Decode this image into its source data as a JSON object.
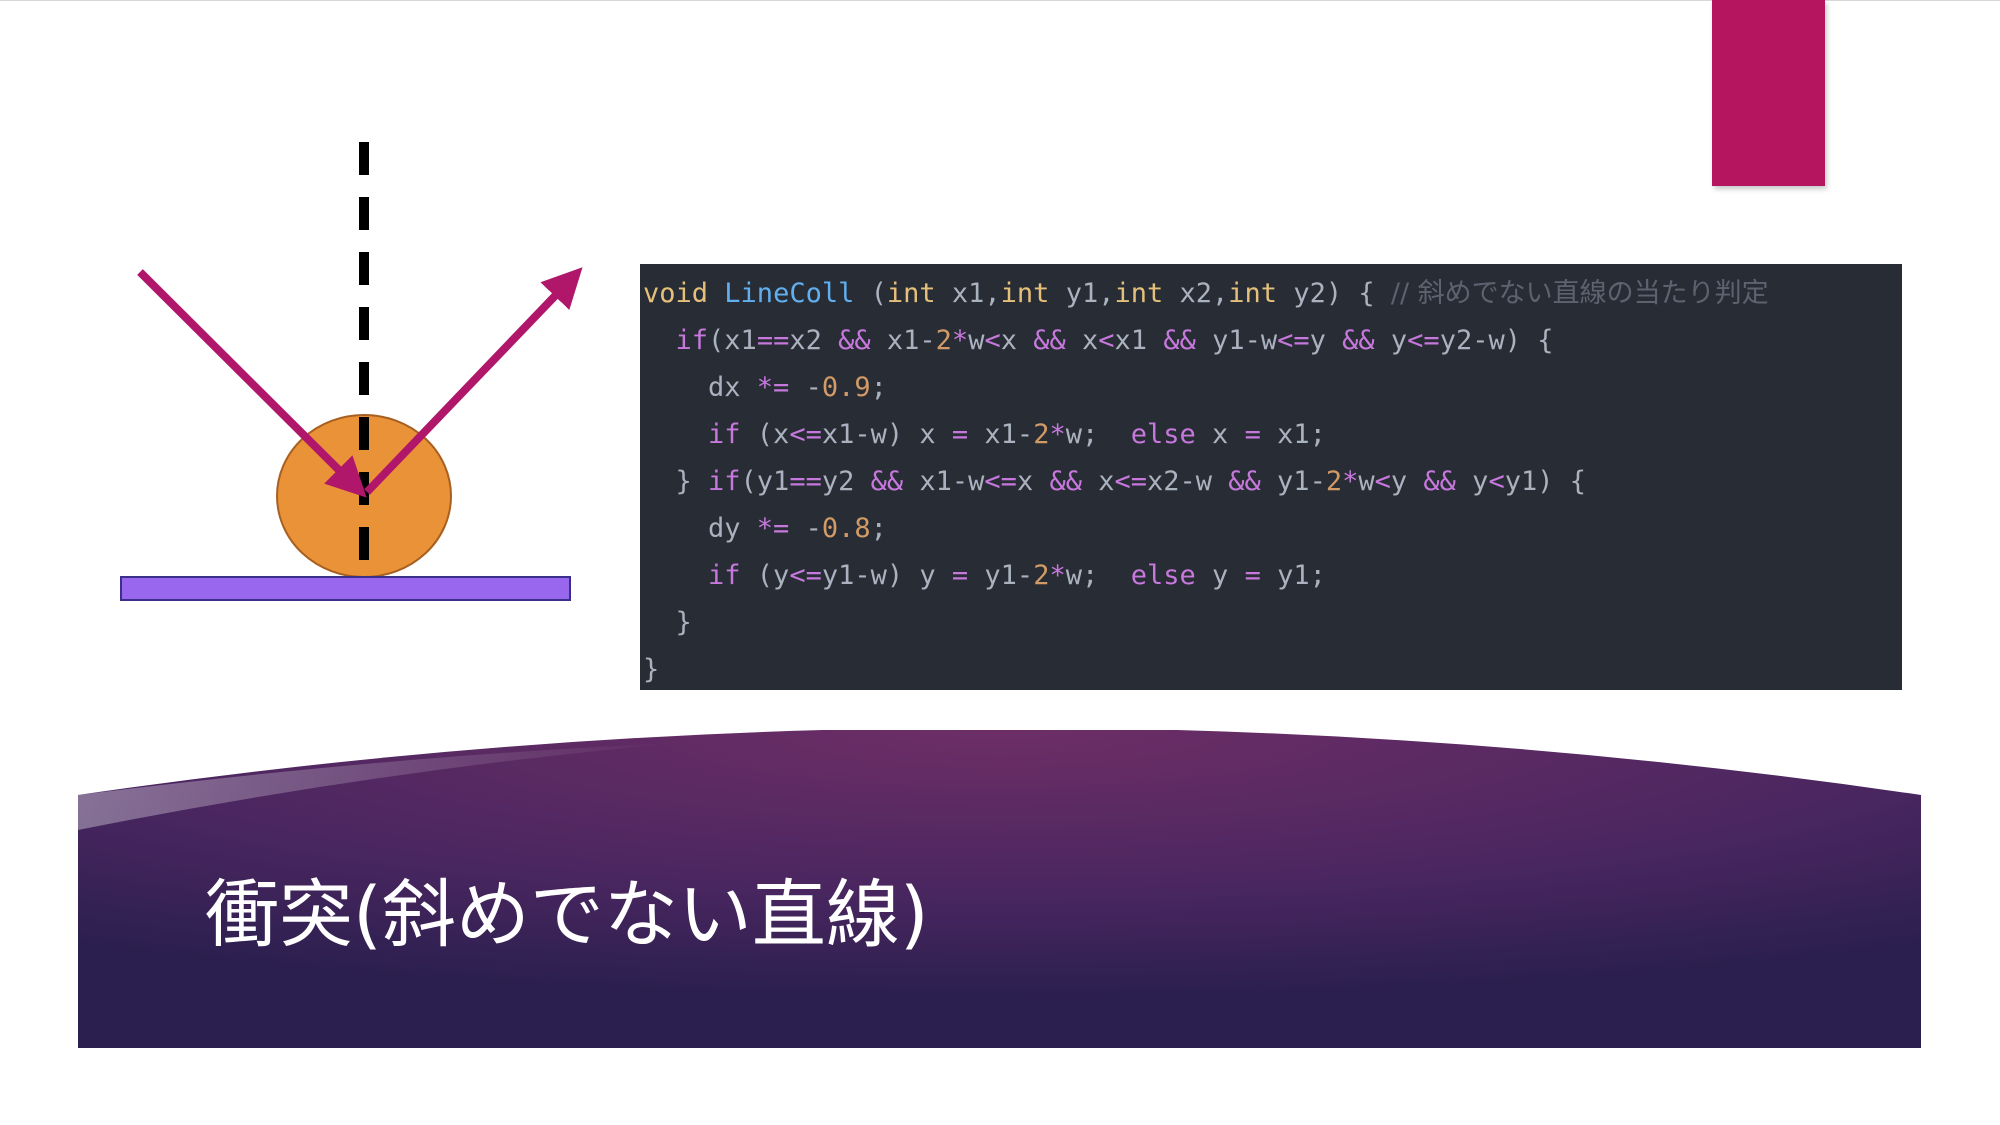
{
  "slide": {
    "title": "衝突(斜めでない直線)",
    "accent_color": "#b5145f"
  },
  "diagram": {
    "ball_color": "#ea9238",
    "surface_color": "#9966ee",
    "arrow_color": "#b0166a",
    "normal_line_color": "#000000"
  },
  "code": {
    "lines": [
      [
        {
          "t": "void",
          "c": "tk-type"
        },
        {
          "t": " ",
          "c": "tk-var"
        },
        {
          "t": "LineColl",
          "c": "tk-func"
        },
        {
          "t": " (",
          "c": "tk-var"
        },
        {
          "t": "int",
          "c": "tk-type"
        },
        {
          "t": " x1,",
          "c": "tk-var"
        },
        {
          "t": "int",
          "c": "tk-type"
        },
        {
          "t": " y1,",
          "c": "tk-var"
        },
        {
          "t": "int",
          "c": "tk-type"
        },
        {
          "t": " x2,",
          "c": "tk-var"
        },
        {
          "t": "int",
          "c": "tk-type"
        },
        {
          "t": " y2) { ",
          "c": "tk-var"
        },
        {
          "t": "// 斜めでない直線の当たり判定",
          "c": "tk-comment"
        }
      ],
      [
        {
          "t": "  ",
          "c": "tk-var"
        },
        {
          "t": "if",
          "c": "tk-kw"
        },
        {
          "t": "(x1",
          "c": "tk-var"
        },
        {
          "t": "==",
          "c": "tk-op"
        },
        {
          "t": "x2 ",
          "c": "tk-var"
        },
        {
          "t": "&&",
          "c": "tk-op"
        },
        {
          "t": " x1-",
          "c": "tk-var"
        },
        {
          "t": "2",
          "c": "tk-num"
        },
        {
          "t": "*",
          "c": "tk-op"
        },
        {
          "t": "w",
          "c": "tk-var"
        },
        {
          "t": "<",
          "c": "tk-op"
        },
        {
          "t": "x ",
          "c": "tk-var"
        },
        {
          "t": "&&",
          "c": "tk-op"
        },
        {
          "t": " x",
          "c": "tk-var"
        },
        {
          "t": "<",
          "c": "tk-op"
        },
        {
          "t": "x1 ",
          "c": "tk-var"
        },
        {
          "t": "&&",
          "c": "tk-op"
        },
        {
          "t": " y1-w",
          "c": "tk-var"
        },
        {
          "t": "<=",
          "c": "tk-op"
        },
        {
          "t": "y ",
          "c": "tk-var"
        },
        {
          "t": "&&",
          "c": "tk-op"
        },
        {
          "t": " y",
          "c": "tk-var"
        },
        {
          "t": "<=",
          "c": "tk-op"
        },
        {
          "t": "y2-w) {",
          "c": "tk-var"
        }
      ],
      [
        {
          "t": "    dx ",
          "c": "tk-var"
        },
        {
          "t": "*=",
          "c": "tk-op"
        },
        {
          "t": " -",
          "c": "tk-var"
        },
        {
          "t": "0.9",
          "c": "tk-num"
        },
        {
          "t": ";",
          "c": "tk-var"
        }
      ],
      [
        {
          "t": "    ",
          "c": "tk-var"
        },
        {
          "t": "if",
          "c": "tk-kw"
        },
        {
          "t": " (x",
          "c": "tk-var"
        },
        {
          "t": "<=",
          "c": "tk-op"
        },
        {
          "t": "x1-w) x ",
          "c": "tk-var"
        },
        {
          "t": "=",
          "c": "tk-op"
        },
        {
          "t": " x1-",
          "c": "tk-var"
        },
        {
          "t": "2",
          "c": "tk-num"
        },
        {
          "t": "*",
          "c": "tk-op"
        },
        {
          "t": "w;  ",
          "c": "tk-var"
        },
        {
          "t": "else",
          "c": "tk-kw"
        },
        {
          "t": " x ",
          "c": "tk-var"
        },
        {
          "t": "=",
          "c": "tk-op"
        },
        {
          "t": " x1;",
          "c": "tk-var"
        }
      ],
      [
        {
          "t": "  } ",
          "c": "tk-var"
        },
        {
          "t": "if",
          "c": "tk-kw"
        },
        {
          "t": "(y1",
          "c": "tk-var"
        },
        {
          "t": "==",
          "c": "tk-op"
        },
        {
          "t": "y2 ",
          "c": "tk-var"
        },
        {
          "t": "&&",
          "c": "tk-op"
        },
        {
          "t": " x1-w",
          "c": "tk-var"
        },
        {
          "t": "<=",
          "c": "tk-op"
        },
        {
          "t": "x ",
          "c": "tk-var"
        },
        {
          "t": "&&",
          "c": "tk-op"
        },
        {
          "t": " x",
          "c": "tk-var"
        },
        {
          "t": "<=",
          "c": "tk-op"
        },
        {
          "t": "x2-w ",
          "c": "tk-var"
        },
        {
          "t": "&&",
          "c": "tk-op"
        },
        {
          "t": " y1-",
          "c": "tk-var"
        },
        {
          "t": "2",
          "c": "tk-num"
        },
        {
          "t": "*",
          "c": "tk-op"
        },
        {
          "t": "w",
          "c": "tk-var"
        },
        {
          "t": "<",
          "c": "tk-op"
        },
        {
          "t": "y ",
          "c": "tk-var"
        },
        {
          "t": "&&",
          "c": "tk-op"
        },
        {
          "t": " y",
          "c": "tk-var"
        },
        {
          "t": "<",
          "c": "tk-op"
        },
        {
          "t": "y1) {",
          "c": "tk-var"
        }
      ],
      [
        {
          "t": "    dy ",
          "c": "tk-var"
        },
        {
          "t": "*=",
          "c": "tk-op"
        },
        {
          "t": " -",
          "c": "tk-var"
        },
        {
          "t": "0.8",
          "c": "tk-num"
        },
        {
          "t": ";",
          "c": "tk-var"
        }
      ],
      [
        {
          "t": "    ",
          "c": "tk-var"
        },
        {
          "t": "if",
          "c": "tk-kw"
        },
        {
          "t": " (y",
          "c": "tk-var"
        },
        {
          "t": "<=",
          "c": "tk-op"
        },
        {
          "t": "y1-w) y ",
          "c": "tk-var"
        },
        {
          "t": "=",
          "c": "tk-op"
        },
        {
          "t": " y1-",
          "c": "tk-var"
        },
        {
          "t": "2",
          "c": "tk-num"
        },
        {
          "t": "*",
          "c": "tk-op"
        },
        {
          "t": "w;  ",
          "c": "tk-var"
        },
        {
          "t": "else",
          "c": "tk-kw"
        },
        {
          "t": " y ",
          "c": "tk-var"
        },
        {
          "t": "=",
          "c": "tk-op"
        },
        {
          "t": " y1;",
          "c": "tk-var"
        }
      ],
      [
        {
          "t": "  }",
          "c": "tk-var"
        }
      ],
      [
        {
          "t": "}",
          "c": "tk-var"
        }
      ]
    ]
  }
}
